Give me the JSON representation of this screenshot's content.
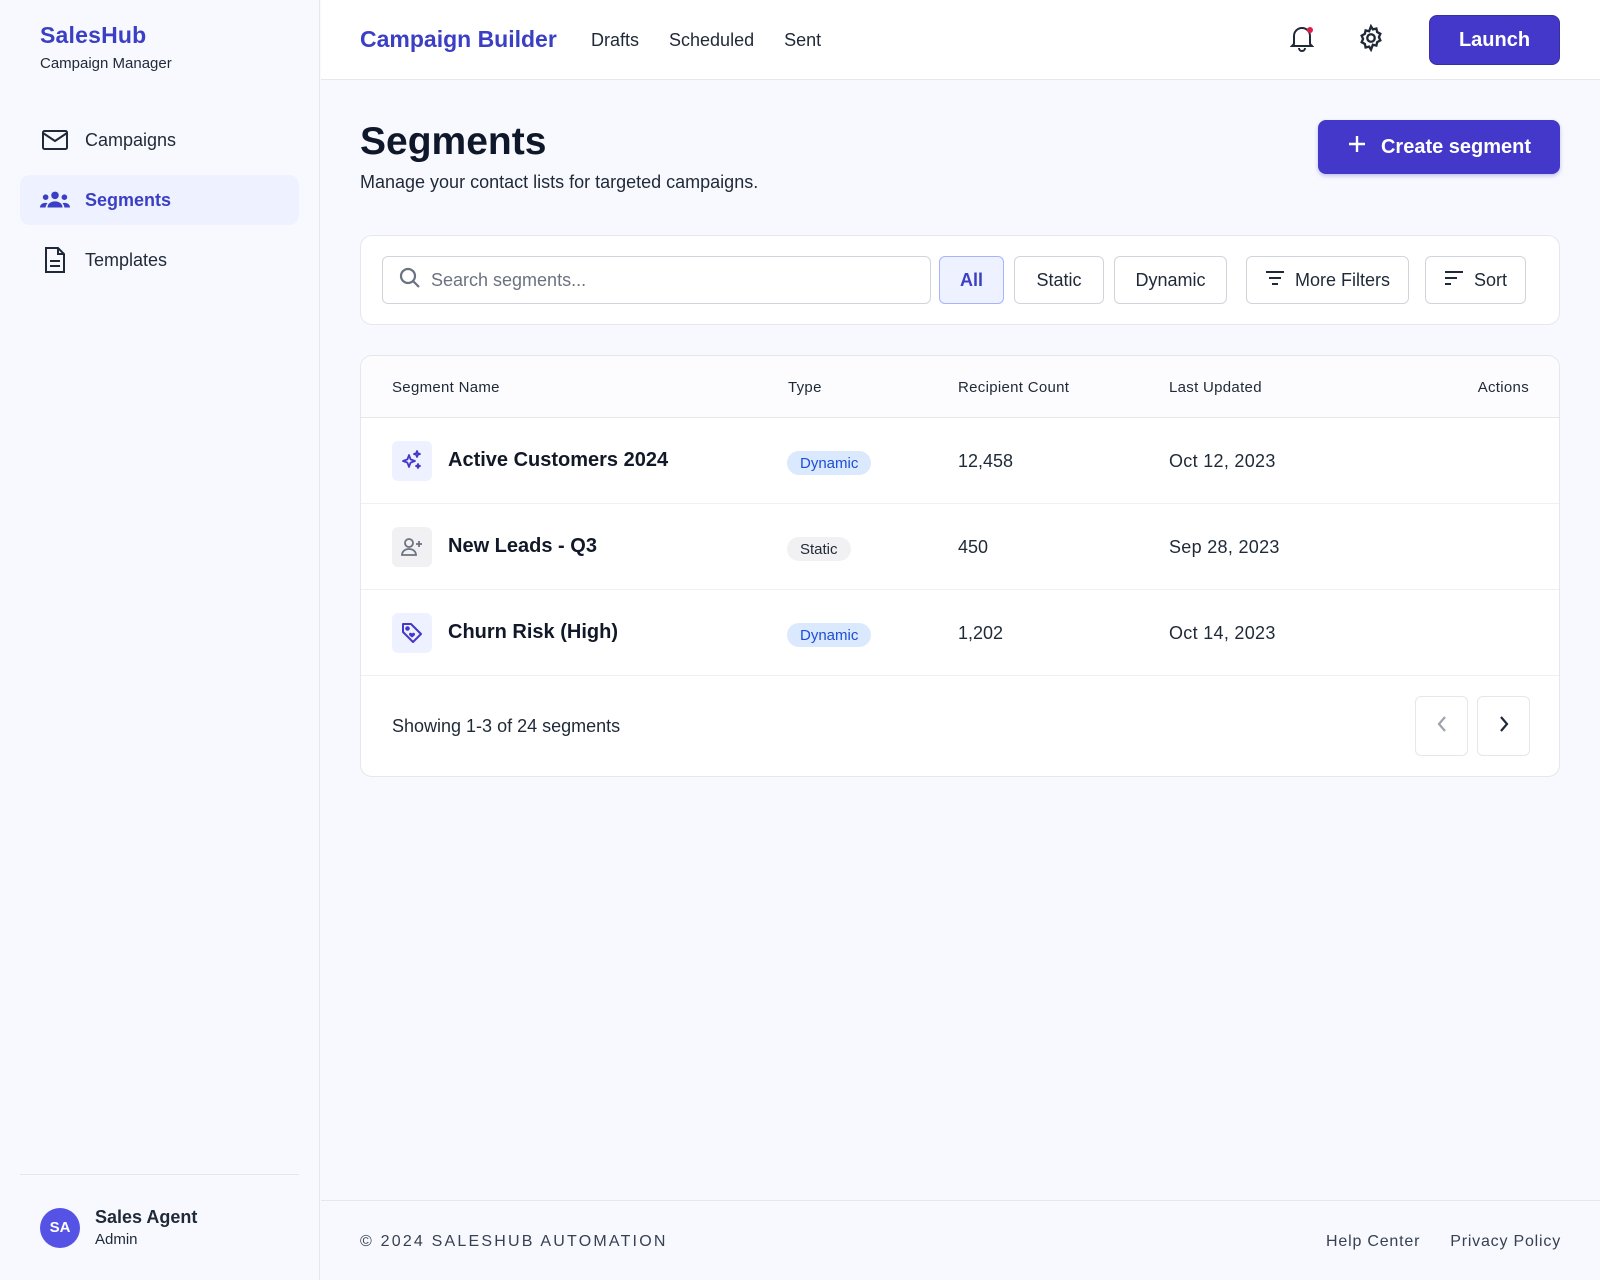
{
  "sidebar": {
    "brand_name": "SalesHub",
    "brand_subtitle": "Campaign Manager",
    "items": [
      {
        "label": "Campaigns",
        "icon": "mail-icon"
      },
      {
        "label": "Segments",
        "icon": "users-icon",
        "active": true
      },
      {
        "label": "Templates",
        "icon": "document-icon"
      }
    ],
    "user": {
      "initials": "SA",
      "name": "Sales Agent",
      "role": "Admin"
    }
  },
  "header": {
    "title": "Campaign Builder",
    "links": [
      "Drafts",
      "Scheduled",
      "Sent"
    ],
    "launch_label": "Launch"
  },
  "main": {
    "title": "Segments",
    "subtitle": "Manage your contact lists for targeted campaigns.",
    "create_label": "Create segment",
    "search_placeholder": "Search segments...",
    "filters": [
      "All",
      "Static",
      "Dynamic"
    ],
    "active_filter": "All",
    "more_filters_label": "More Filters",
    "sort_label": "Sort",
    "table": {
      "columns": [
        "Segment Name",
        "Type",
        "Recipient Count",
        "Last Updated",
        "Actions"
      ],
      "rows": [
        {
          "name": "Active Customers 2024",
          "type": "Dynamic",
          "count": "12,458",
          "updated": "Oct 12, 2023",
          "icon": "sparkles-icon"
        },
        {
          "name": "New Leads - Q3",
          "type": "Static",
          "count": "450",
          "updated": "Sep 28, 2023",
          "icon": "user-plus-icon"
        },
        {
          "name": "Churn Risk (High)",
          "type": "Dynamic",
          "count": "1,202",
          "updated": "Oct 14, 2023",
          "icon": "tag-icon"
        }
      ]
    },
    "pagination_text": "Showing 1-3 of 24 segments"
  },
  "footer": {
    "copyright": "© 2024 SALESHUB AUTOMATION",
    "links": [
      "Help Center",
      "Privacy Policy"
    ]
  },
  "colors": {
    "accent": "#4338ca",
    "brand": "#3b3fc4",
    "dynamic_badge": "#dbe9fe",
    "static_badge": "#f1f1f3",
    "notification_dot": "#e11d48"
  }
}
